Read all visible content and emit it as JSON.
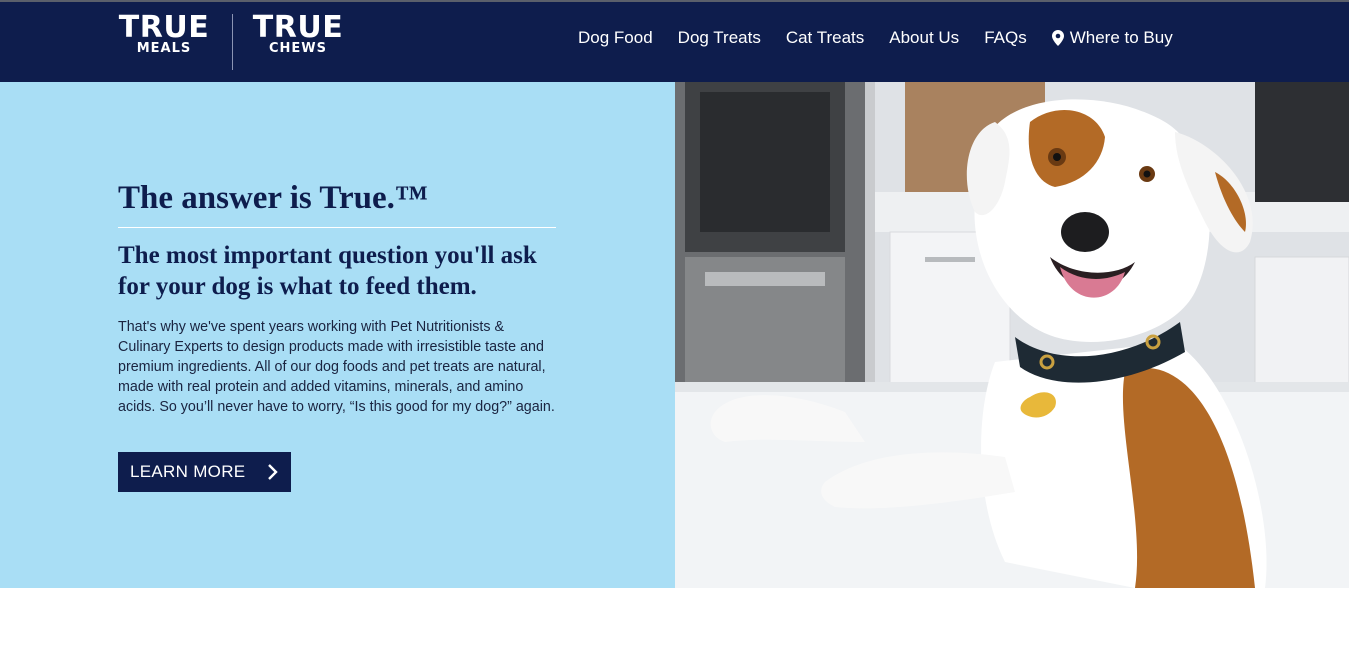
{
  "header": {
    "logo_meals": {
      "big": "TRUE",
      "small": "MEALS"
    },
    "logo_chews": {
      "big": "TRUE",
      "small": "CHEWS"
    },
    "nav": [
      {
        "label": "Dog Food"
      },
      {
        "label": "Dog Treats"
      },
      {
        "label": "Cat Treats"
      },
      {
        "label": "About Us"
      },
      {
        "label": "FAQs"
      },
      {
        "label": "Where to Buy",
        "icon": "map-pin-icon"
      }
    ]
  },
  "hero": {
    "title": "The answer is True.™",
    "subtitle": "The most important question you'll ask for your dog is what to feed them.",
    "body": "That's why we've spent years working with Pet Nutritionists & Culinary Experts to design products made with irresistible taste and premium ingredients. All of our dog foods and pet treats are natural, made with real protein and added vitamins, minerals, and amino acids. So you’ll never have to worry, “Is this good for my dog?” again.",
    "cta_label": "LEARN MORE",
    "cta_icon": "chevron-right-icon",
    "image": "dog-photo"
  },
  "colors": {
    "navy": "#0e1d4d",
    "hero_bg": "#a9def5",
    "white": "#ffffff"
  }
}
